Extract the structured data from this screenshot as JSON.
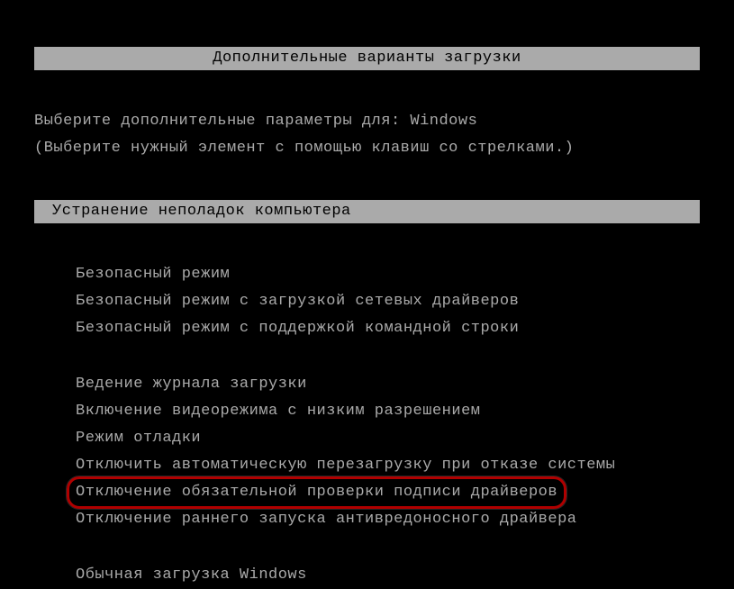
{
  "title": "Дополнительные варианты загрузки",
  "prompt": {
    "line1_prefix": "Выберите дополнительные параметры для: ",
    "os_name": "Windows",
    "line2": "(Выберите нужный элемент с помощью клавиш со стрелками.)"
  },
  "selected": {
    "label": "Устранение неполадок компьютера"
  },
  "menu": {
    "group1": [
      "Безопасный режим",
      "Безопасный режим с загрузкой сетевых драйверов",
      "Безопасный режим с поддержкой командной строки"
    ],
    "group2": [
      "Ведение журнала загрузки",
      "Включение видеорежима с низким разрешением",
      "Режим отладки",
      "Отключить автоматическую перезагрузку при отказе системы",
      "Отключение обязательной проверки подписи драйверов",
      "Отключение раннего запуска антивредоносного драйвера"
    ],
    "group3": [
      "Обычная загрузка Windows"
    ]
  },
  "highlighted_index": 4
}
